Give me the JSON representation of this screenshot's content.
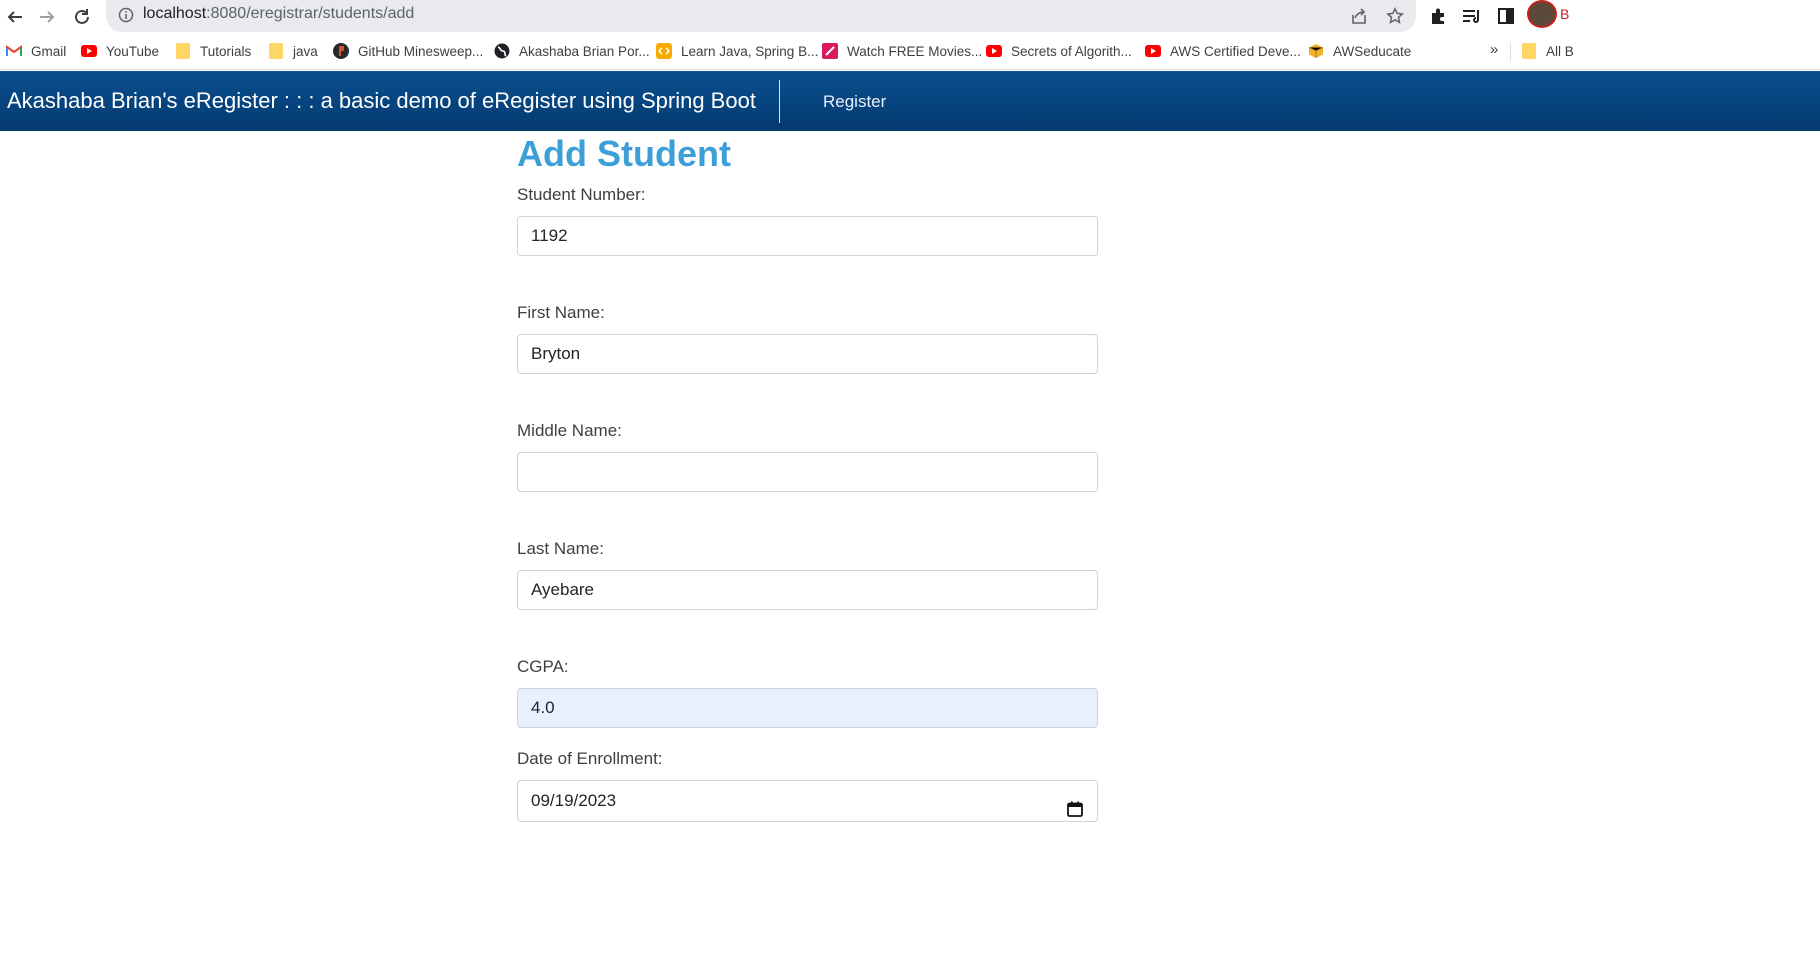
{
  "browser": {
    "url_host": "localhost",
    "url_rest": ":8080/eregistrar/students/add",
    "profile_letter": "B",
    "bookmarks": [
      {
        "label": "Gmail",
        "icon": "gmail-icon"
      },
      {
        "label": "YouTube",
        "icon": "youtube-icon"
      },
      {
        "label": "Tutorials",
        "icon": "folder-icon"
      },
      {
        "label": "java",
        "icon": "folder-icon"
      },
      {
        "label": "GitHub Minesweep...",
        "icon": "site-icon"
      },
      {
        "label": "Akashaba Brian Por...",
        "icon": "globe-icon"
      },
      {
        "label": "Learn Java, Spring B...",
        "icon": "code-icon"
      },
      {
        "label": "Watch FREE Movies...",
        "icon": "site-icon"
      },
      {
        "label": "Secrets of Algorith...",
        "icon": "youtube-icon"
      },
      {
        "label": "AWS Certified Deve...",
        "icon": "youtube-icon"
      },
      {
        "label": "AWSeducate",
        "icon": "box-icon"
      }
    ],
    "more_label": "»",
    "all_bookmarks_label": "All B"
  },
  "app": {
    "brand": "Akashaba Brian's eRegister : : : a basic demo of eRegister using Spring Boot",
    "nav_register": "Register"
  },
  "form": {
    "title": "Add Student",
    "student_number_label": "Student Number:",
    "student_number_value": "1192",
    "first_name_label": "First Name:",
    "first_name_value": "Bryton",
    "middle_name_label": "Middle Name:",
    "middle_name_value": "",
    "last_name_label": "Last Name:",
    "last_name_value": "Ayebare",
    "cgpa_label": "CGPA:",
    "cgpa_value": "4.0",
    "date_label": "Date of Enrollment:",
    "date_value": "09/19/2023"
  },
  "colors": {
    "navbar": "#033a70",
    "title": "#3d9fd8",
    "autofill": "#e8f0fe"
  }
}
